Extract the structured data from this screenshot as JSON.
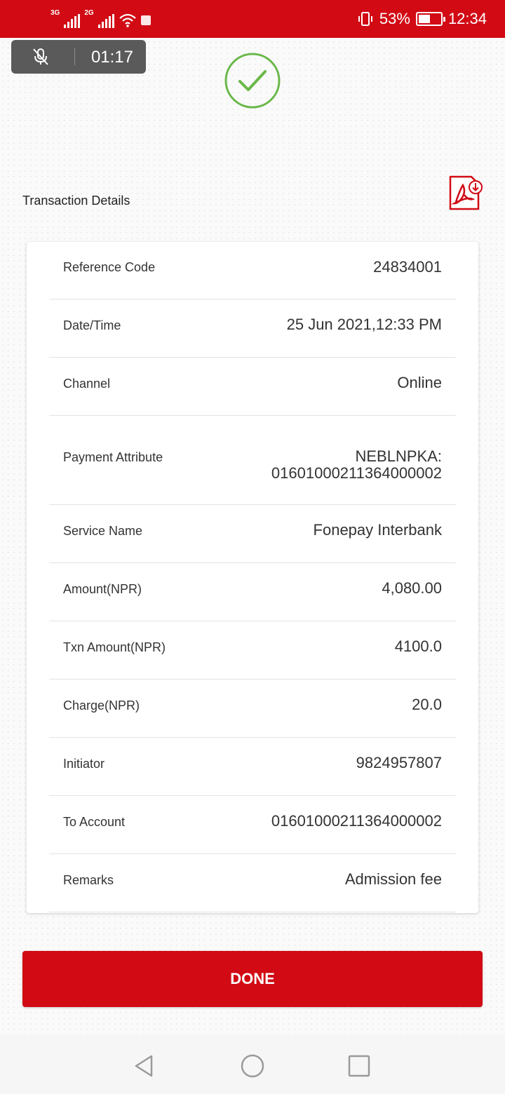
{
  "status_bar": {
    "network_1": "3G",
    "network_2": "2G",
    "battery_percent": "53%",
    "battery_level": 0.53,
    "time": "12:34"
  },
  "recording": {
    "elapsed": "01:17",
    "icon": "mic-off-icon"
  },
  "header": {
    "success_icon": "check-circle-icon",
    "section_title": "Transaction Details",
    "pdf_icon": "pdf-download-icon"
  },
  "details": [
    {
      "label": "Reference Code",
      "value": "24834001"
    },
    {
      "label": "Date/Time",
      "value": "25 Jun 2021,12:33 PM"
    },
    {
      "label": "Channel",
      "value": "Online"
    },
    {
      "label": "Payment Attribute",
      "value": "NEBLNPKA:",
      "value_line2": "01601000211364000002"
    },
    {
      "label": "Service Name",
      "value": "Fonepay Interbank"
    },
    {
      "label": "Amount(NPR)",
      "value": "4,080.00"
    },
    {
      "label": "Txn Amount(NPR)",
      "value": "4100.0"
    },
    {
      "label": "Charge(NPR)",
      "value": "20.0"
    },
    {
      "label": "Initiator",
      "value": "9824957807"
    },
    {
      "label": "To Account",
      "value": "01601000211364000002"
    },
    {
      "label": "Remarks",
      "value": "Admission fee"
    }
  ],
  "actions": {
    "done_label": "DONE"
  },
  "colors": {
    "brand_red": "#d10a14",
    "success_green": "#6ab84a"
  }
}
